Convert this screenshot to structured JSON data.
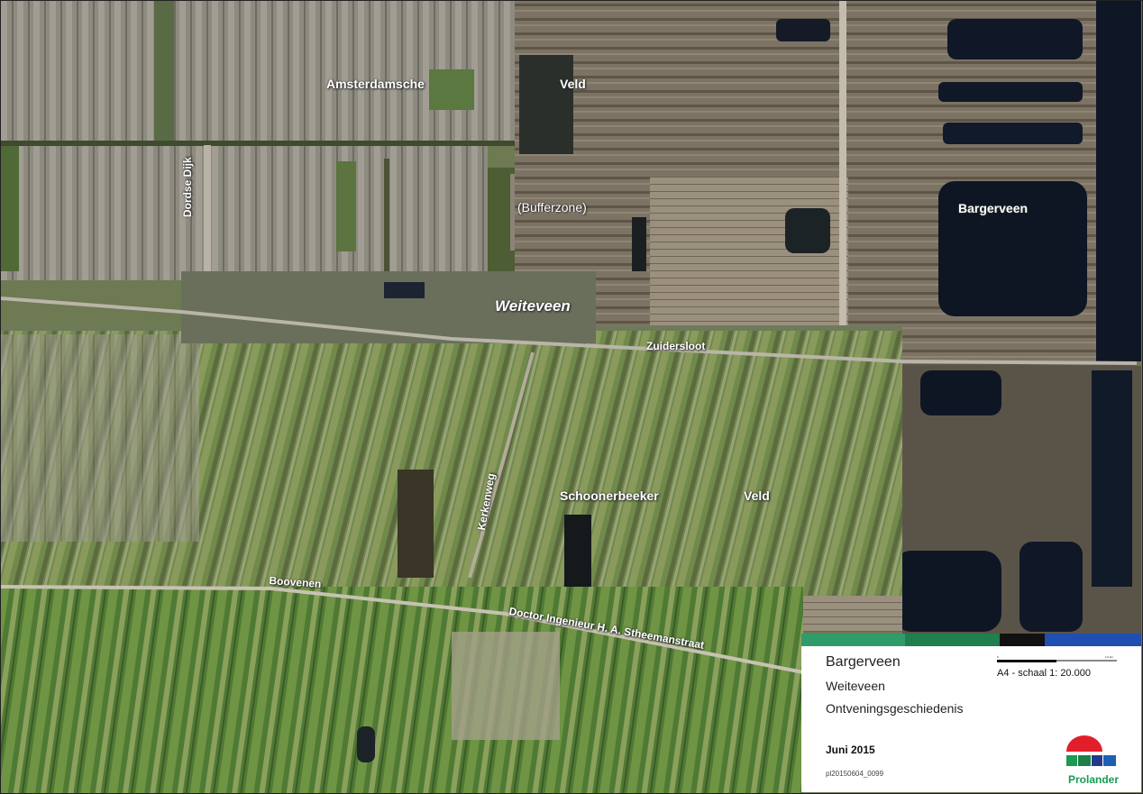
{
  "map": {
    "labels": {
      "amsterdamsche": "Amsterdamsche",
      "veld_top": "Veld",
      "dordse_dijk": "Dordse Dijk",
      "bufferzone": "(Bufferzone)",
      "bargerveen": "Bargerveen",
      "weiteveen": "Weiteveen",
      "zuidersloot": "Zuidersloot",
      "kerkenweg": "Kerkenweg",
      "schoonerbeeker": "Schoonerbeeker",
      "veld_bottom": "Veld",
      "boovenen": "Boovenen",
      "stheemanstraat": "Doctor Ingenieur H. A. Stheemanstraat"
    }
  },
  "legend": {
    "title": "Bargerveen",
    "subtitle": "Weiteveen",
    "description": "Ontveningsgeschiedenis",
    "date": "Juni 2015",
    "code": "pl20150604_0099",
    "scale": "A4 - schaal 1: 20.000",
    "scalebar_start": "0",
    "scalebar_end": "1,0 km",
    "logo_text": "Prolander",
    "bar_colors": [
      "#2f9c6a",
      "#1f7f4e",
      "#111111",
      "#ffffff",
      "#1f4fb0"
    ]
  }
}
